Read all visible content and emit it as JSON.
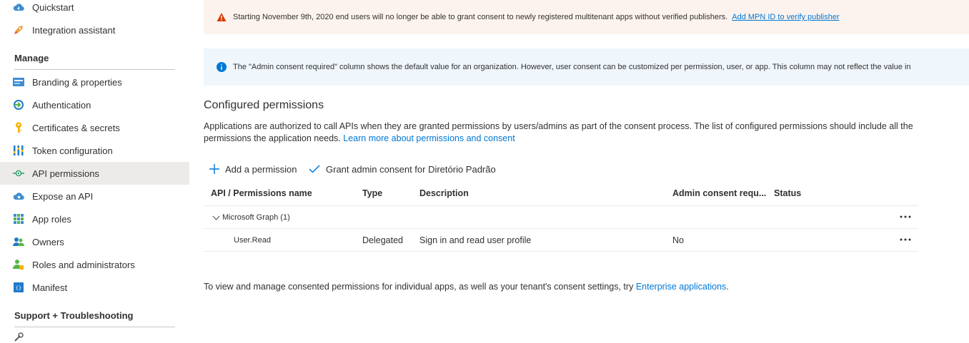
{
  "sidebar": {
    "top_items": [
      {
        "label": "Quickstart",
        "icon": "quickstart-cloud-icon"
      },
      {
        "label": "Integration assistant",
        "icon": "rocket-icon"
      }
    ],
    "manage_title": "Manage",
    "manage_items": [
      {
        "label": "Branding & properties",
        "icon": "branding-icon"
      },
      {
        "label": "Authentication",
        "icon": "authentication-icon"
      },
      {
        "label": "Certificates & secrets",
        "icon": "key-icon"
      },
      {
        "label": "Token configuration",
        "icon": "token-bars-icon"
      },
      {
        "label": "API permissions",
        "icon": "api-permissions-icon",
        "selected": true
      },
      {
        "label": "Expose an API",
        "icon": "cloud-expose-icon"
      },
      {
        "label": "App roles",
        "icon": "app-roles-grid-icon"
      },
      {
        "label": "Owners",
        "icon": "owners-icon"
      },
      {
        "label": "Roles and administrators",
        "icon": "roles-admin-icon"
      },
      {
        "label": "Manifest",
        "icon": "manifest-icon"
      }
    ],
    "support_title": "Support + Troubleshooting"
  },
  "warning_banner": {
    "text": "Starting November 9th, 2020 end users will no longer be able to grant consent to newly registered multitenant apps without verified publishers.",
    "link": "Add MPN ID to verify publisher",
    "icon": "warning-triangle-icon"
  },
  "info_banner": {
    "text": "The \"Admin consent required\" column shows the default value for an organization. However, user consent can be customized per permission, user, or app. This column may not reflect the value in",
    "icon": "info-icon"
  },
  "configured": {
    "title": "Configured permissions",
    "description": "Applications are authorized to call APIs when they are granted permissions by users/admins as part of the consent process. The list of configured permissions should include all the permissions the application needs.",
    "learn_more": "Learn more about permissions and consent"
  },
  "toolbar": {
    "add_permission": "Add a permission",
    "grant_consent": "Grant admin consent for Diretório Padrão"
  },
  "table": {
    "columns": [
      "API / Permissions name",
      "Type",
      "Description",
      "Admin consent requ...",
      "Status"
    ],
    "group": "Microsoft Graph (1)",
    "rows": [
      {
        "name": "User.Read",
        "type": "Delegated",
        "description": "Sign in and read user profile",
        "admin_consent": "No",
        "status": ""
      }
    ]
  },
  "footer": {
    "text": "To view and manage consented permissions for individual apps, as well as your tenant's consent settings, try",
    "link": "Enterprise applications",
    "end": "."
  },
  "colors": {
    "accent": "#0078d4",
    "warning_bg": "#fdf3ee",
    "info_bg": "#eff6fc",
    "selected_bg": "#edebe9"
  }
}
